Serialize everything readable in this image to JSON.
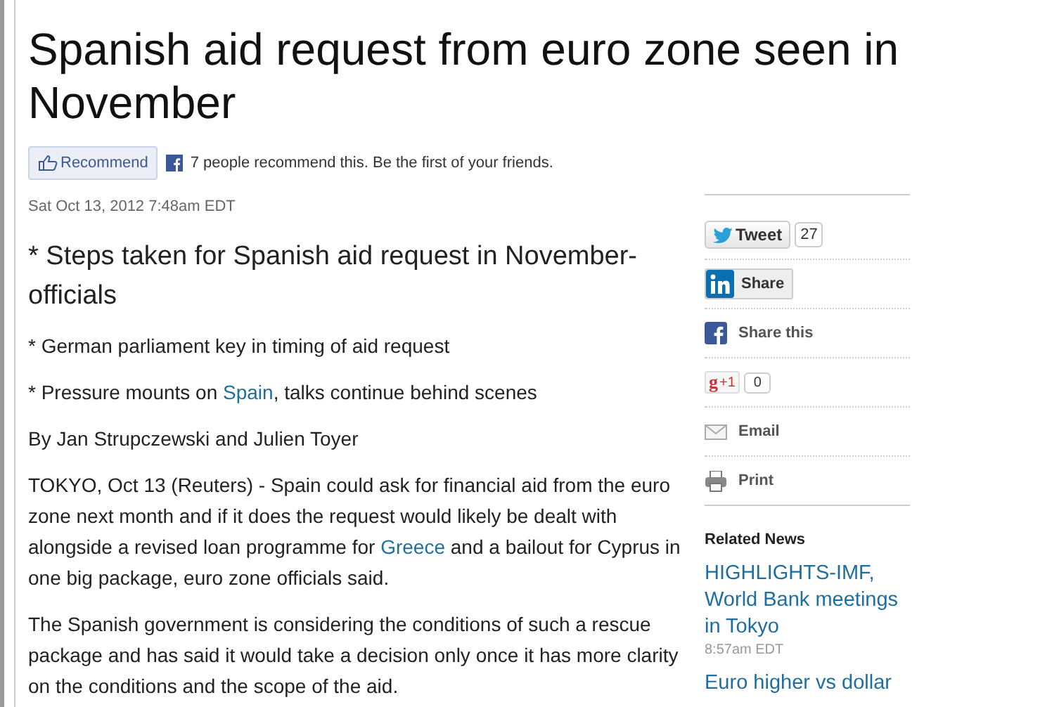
{
  "headline": "Spanish aid request from euro zone seen in November",
  "recommend": {
    "button": "Recommend",
    "text": "7 people recommend this. Be the first of your friends."
  },
  "timestamp": "Sat Oct 13, 2012 7:48am EDT",
  "summary": "* Steps taken for Spanish aid request in November-officials",
  "paragraphs": [
    [
      {
        "text": "* German parliament key in timing of aid request",
        "link": false
      }
    ],
    [
      {
        "text": "* Pressure mounts on ",
        "link": false
      },
      {
        "text": "Spain",
        "link": true
      },
      {
        "text": ", talks continue behind scenes",
        "link": false
      }
    ],
    [
      {
        "text": "By Jan Strupczewski and Julien Toyer",
        "link": false
      }
    ],
    [
      {
        "text": "TOKYO, Oct 13 (Reuters) - Spain could ask for financial aid from the euro zone next month and if it does the request would likely be dealt with alongside a revised loan programme for ",
        "link": false
      },
      {
        "text": "Greece",
        "link": true
      },
      {
        "text": " and a bailout for Cyprus in one big package, euro zone officials said.",
        "link": false
      }
    ],
    [
      {
        "text": "The Spanish government is considering the conditions of such a rescue package and has said it would take a decision only once it has more clarity on the conditions and the scope of the aid.",
        "link": false
      }
    ]
  ],
  "share": [
    {
      "kind": "tweet",
      "label": "Tweet",
      "count": "27"
    },
    {
      "kind": "linkedin",
      "label": "Share"
    },
    {
      "kind": "facebook",
      "label": "Share this"
    },
    {
      "kind": "gplus",
      "glyph": "g",
      "label": "+1",
      "count": "0"
    },
    {
      "kind": "email",
      "label": "Email"
    },
    {
      "kind": "print",
      "label": "Print"
    }
  ],
  "related": {
    "heading": "Related News",
    "items": [
      {
        "title": "HIGHLIGHTS-IMF, World Bank meetings in Tokyo",
        "time": "8:57am EDT"
      },
      {
        "title": "Euro higher vs dollar"
      }
    ]
  }
}
